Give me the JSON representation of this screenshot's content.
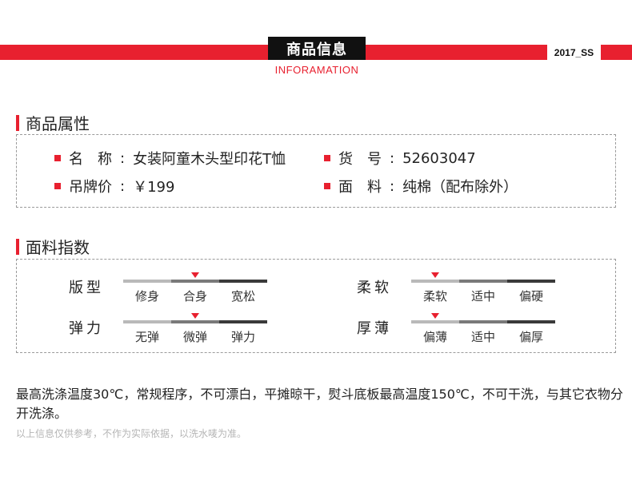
{
  "banner": {
    "title": "商品信息",
    "subtitle": "INFORAMATION",
    "season": "2017_SS"
  },
  "attributes_section": {
    "heading": "商品属性",
    "items": [
      {
        "label": "名　称",
        "value": "女装阿童木头型印花T恤"
      },
      {
        "label": "货　号",
        "value": "52603047"
      },
      {
        "label": "吊牌价",
        "value": "￥199"
      },
      {
        "label": "面　料",
        "value": "纯棉（配布除外）"
      }
    ]
  },
  "fabric_section": {
    "heading": "面料指数",
    "indicators": [
      {
        "name": "版型",
        "options": [
          "修身",
          "合身",
          "宽松"
        ],
        "selected_index": 1
      },
      {
        "name": "柔软",
        "options": [
          "柔软",
          "适中",
          "偏硬"
        ],
        "selected_index": 0
      },
      {
        "name": "弹力",
        "options": [
          "无弹",
          "微弹",
          "弹力"
        ],
        "selected_index": 1
      },
      {
        "name": "厚薄",
        "options": [
          "偏薄",
          "适中",
          "偏厚"
        ],
        "selected_index": 0
      }
    ]
  },
  "care_text": "最高洗涤温度30℃，常规程序，不可漂白，平摊晾干，熨斗底板最高温度150℃，不可干洗，与其它衣物分开洗涤。",
  "disclaimer": "以上信息仅供参考，不作为实际依据，以洗水唛为准。",
  "colors": {
    "accent": "#e8202f",
    "dark": "#111111"
  }
}
